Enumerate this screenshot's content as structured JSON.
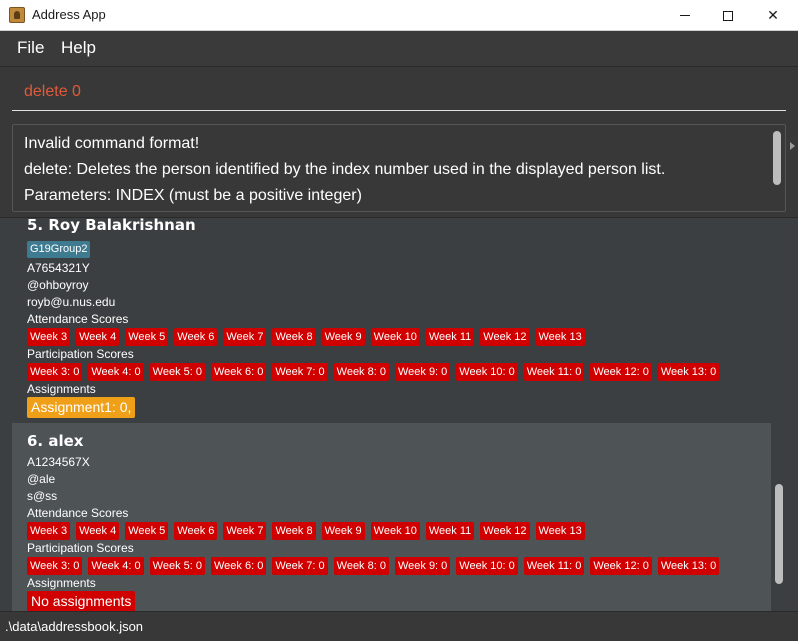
{
  "window": {
    "title": "Address App"
  },
  "menu": {
    "file": "File",
    "help": "Help"
  },
  "command": {
    "value": "delete 0"
  },
  "result": {
    "lines": [
      "Invalid command format!",
      "delete: Deletes the person identified by the index number used in the displayed person list.",
      "Parameters: INDEX (must be a positive integer)"
    ]
  },
  "persons": [
    {
      "index_name": "5.  Roy Balakrishnan",
      "tag": "G19Group2",
      "student_id": "A7654321Y",
      "telegram": "@ohboyroy",
      "email": "royb@u.nus.edu",
      "attendance_label": "Attendance Scores",
      "attendance": [
        "Week 3",
        "Week 4",
        "Week 5",
        "Week 6",
        "Week 7",
        "Week 8",
        "Week 9",
        "Week 10",
        "Week 11",
        "Week 12",
        "Week 13"
      ],
      "participation_label": "Participation Scores",
      "participation": [
        "Week 3: 0",
        "Week 4: 0",
        "Week 5: 0",
        "Week 6: 0",
        "Week 7: 0",
        "Week 8: 0",
        "Week 9: 0",
        "Week 10: 0",
        "Week 11: 0",
        "Week 12: 0",
        "Week 13: 0"
      ],
      "assignments_label": "Assignments",
      "assignment": "Assignment1: 0,"
    },
    {
      "index_name": "6.  alex",
      "student_id": "A1234567X",
      "telegram": "@ale",
      "email": "s@ss",
      "attendance_label": "Attendance Scores",
      "attendance": [
        "Week 3",
        "Week 4",
        "Week 5",
        "Week 6",
        "Week 7",
        "Week 8",
        "Week 9",
        "Week 10",
        "Week 11",
        "Week 12",
        "Week 13"
      ],
      "participation_label": "Participation Scores",
      "participation": [
        "Week 3: 0",
        "Week 4: 0",
        "Week 5: 0",
        "Week 6: 0",
        "Week 7: 0",
        "Week 8: 0",
        "Week 9: 0",
        "Week 10: 0",
        "Week 11: 0",
        "Week 12: 0",
        "Week 13: 0"
      ],
      "assignments_label": "Assignments",
      "assignment": "No assignments"
    }
  ],
  "status": {
    "path": ".\\data\\addressbook.json"
  },
  "colors": {
    "chip_red": "#d00000",
    "tag_blue": "#3e7b91",
    "assignment_orange": "#f0a018",
    "command_text": "#e05a3a"
  }
}
